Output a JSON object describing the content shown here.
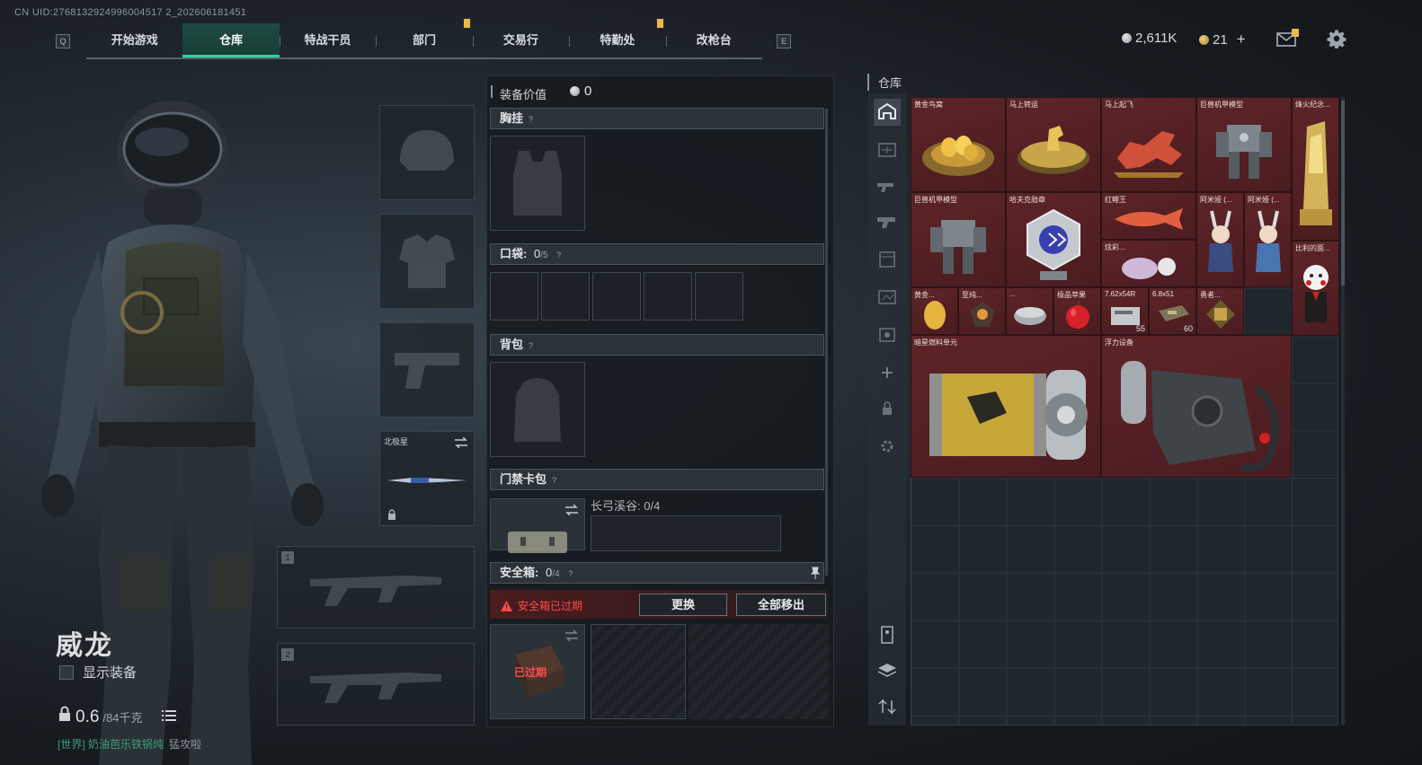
{
  "uid": "CN UID:2768132924996004517 2_202606181451",
  "nav": {
    "key_left": "Q",
    "key_right": "E",
    "tabs": [
      {
        "label": "开始游戏"
      },
      {
        "label": "仓库"
      },
      {
        "label": "特战干员"
      },
      {
        "label": "部门"
      },
      {
        "label": "交易行"
      },
      {
        "label": "特勤处"
      },
      {
        "label": "改枪台"
      }
    ],
    "active_tab": "仓库"
  },
  "header_right": {
    "currency_a": "2,611K",
    "currency_b": "21",
    "plus": "+"
  },
  "character": {
    "name": "威龙",
    "show_equipment": "显示装备",
    "weight_current": "0.6",
    "weight_max": "/84千克",
    "chat_channel": "[世界] 奶油芭乐铁锅炖",
    "chat_message": "猛攻啦"
  },
  "gear_slots": {
    "melee_label": "北极星",
    "primary_num": "1",
    "secondary_num": "2"
  },
  "loadout": {
    "value_label": "装备价值",
    "value": "0",
    "chest_rig": "胸挂",
    "pockets_label": "口袋:",
    "pockets_used": "0",
    "pockets_total": "/5",
    "backpack": "背包",
    "keycard": "门禁卡包",
    "keycard_map": "长弓溪谷: 0/4",
    "safebox_label": "安全箱:",
    "safebox_used": "0",
    "safebox_total": "/4",
    "expired_warning": "安全箱已过期",
    "replace_button": "更换",
    "remove_all_button": "全部移出",
    "expired_badge": "已过期",
    "help": "?"
  },
  "warehouse": {
    "title": "仓库",
    "items": [
      {
        "name": "黄金鸟窝"
      },
      {
        "name": "马上转运"
      },
      {
        "name": "马上起飞"
      },
      {
        "name": "巨兽机甲模型"
      },
      {
        "name": "烽火纪念..."
      },
      {
        "name": "巨兽机甲模型"
      },
      {
        "name": "哈夫克勋章"
      },
      {
        "name": "红鲤王"
      },
      {
        "name": "阿米娅 (..."
      },
      {
        "name": "阿米娅 (..."
      },
      {
        "name": "炫彩..."
      },
      {
        "name": "比利的面..."
      },
      {
        "name": "黄金..."
      },
      {
        "name": "至纯..."
      },
      {
        "name": "..."
      },
      {
        "name": "极品苹果"
      },
      {
        "name": "7.62x54R",
        "qty": "55"
      },
      {
        "name": "6.8x51",
        "qty": "60"
      },
      {
        "name": "勇者..."
      },
      {
        "name": "暗星燃料单元"
      },
      {
        "name": "浮力设备"
      }
    ]
  },
  "colors": {
    "accent": "#2fd3a4",
    "item_bg": "#5e2428",
    "warning": "#ff4a4a"
  }
}
